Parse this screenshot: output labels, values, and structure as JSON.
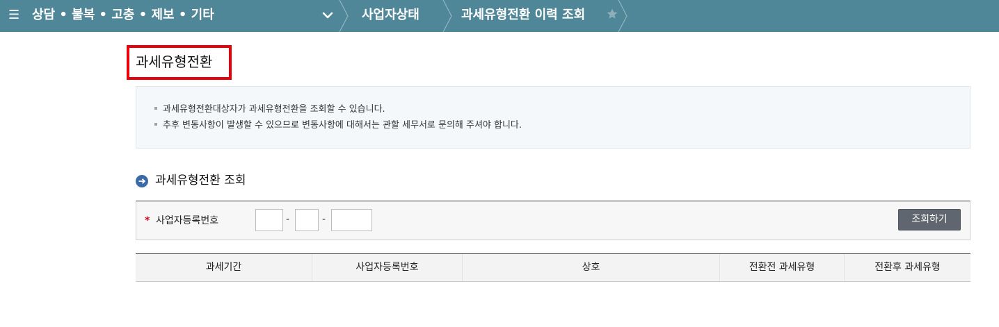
{
  "nav": {
    "menu_glyph": "☰",
    "category": "상담 • 불복 • 고충 • 제보 • 기타",
    "crumb_1": "사업자상태",
    "crumb_2": "과세유형전환 이력 조회"
  },
  "page": {
    "title": "과세유형전환"
  },
  "info": {
    "lines": [
      "과세유형전환대상자가 과세유형전환을 조회할 수 있습니다.",
      "추후 변동사항이 발생할 수 있으므로 변동사항에 대해서는 관할 세무서로 문의해 주셔야 합니다."
    ]
  },
  "section": {
    "title": "과세유형전환 조회"
  },
  "search": {
    "required_mark": "*",
    "label": "사업자등록번호",
    "brn_part1": "",
    "brn_part2": "",
    "brn_part3": "",
    "separator": "-",
    "button_label": "조회하기"
  },
  "results": {
    "columns": [
      "과세기간",
      "사업자등록번호",
      "상호",
      "전환전 과세유형",
      "전환후 과세유형"
    ]
  },
  "colors": {
    "topbar": "#4f8798",
    "highlight": "#e8000b",
    "button": "#5f666f"
  }
}
